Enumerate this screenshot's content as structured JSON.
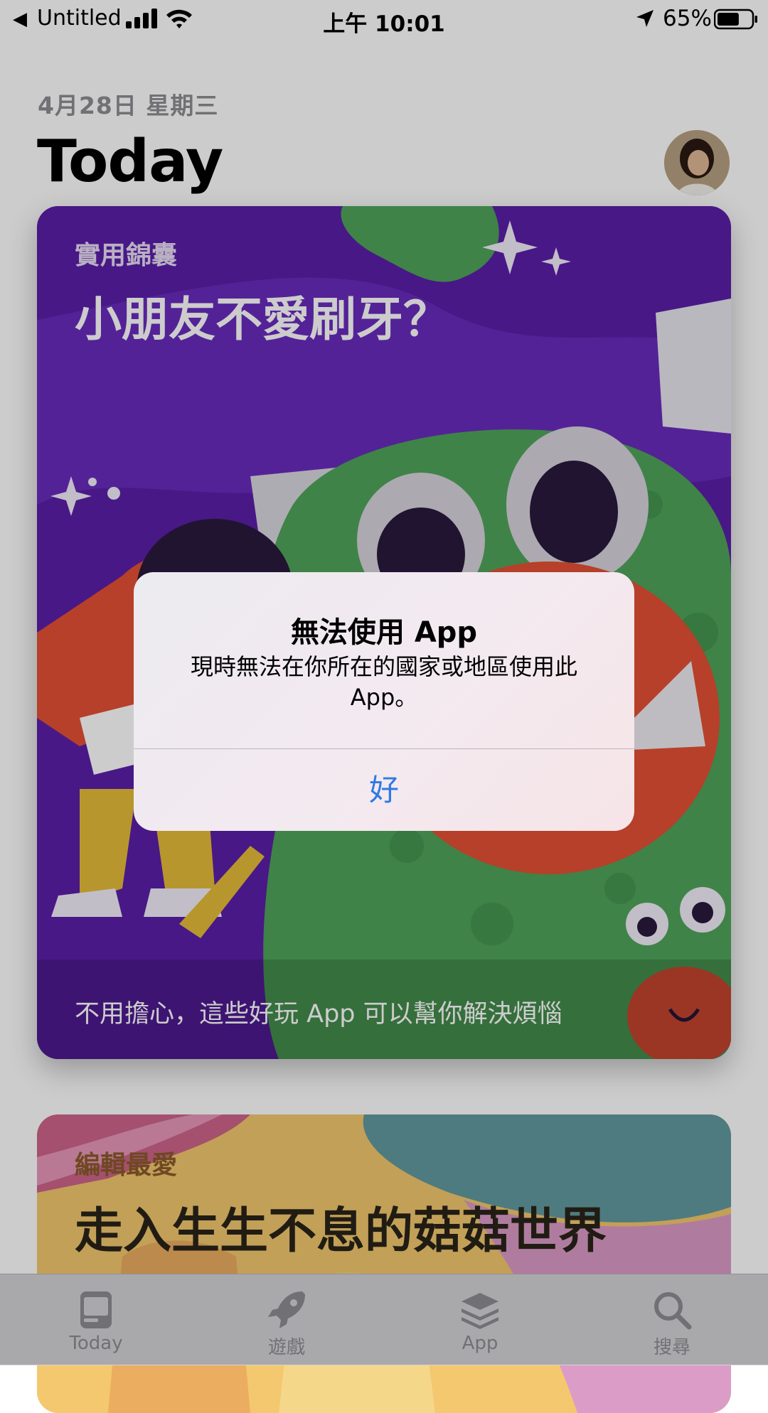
{
  "status_bar": {
    "back_app": "Untitled",
    "time": "上午 10:01",
    "battery_percent": "65%",
    "battery_level": 0.65
  },
  "header": {
    "date": "4月28日 星期三",
    "title": "Today"
  },
  "cards": [
    {
      "eyebrow": "實用錦囊",
      "title": "小朋友不愛刷牙？",
      "subtitle": "不用擔心，這些好玩 App 可以幫你解決煩惱"
    },
    {
      "eyebrow": "編輯最愛",
      "title": "走入生生不息的菇菇世界"
    }
  ],
  "alert": {
    "title": "無法使用 App",
    "message": "現時無法在你所在的國家或地區使用此 App。",
    "ok_label": "好"
  },
  "tab_bar": {
    "items": [
      {
        "label": "Today",
        "icon": "today-icon",
        "active": true
      },
      {
        "label": "遊戲",
        "icon": "rocket-icon",
        "active": false
      },
      {
        "label": "App",
        "icon": "apps-stack-icon",
        "active": false
      },
      {
        "label": "搜尋",
        "icon": "search-icon",
        "active": false
      }
    ]
  },
  "colors": {
    "accent": "#2f7ae5",
    "card1_bg": "#5b1ea8",
    "monster_green": "#4fa45a"
  }
}
